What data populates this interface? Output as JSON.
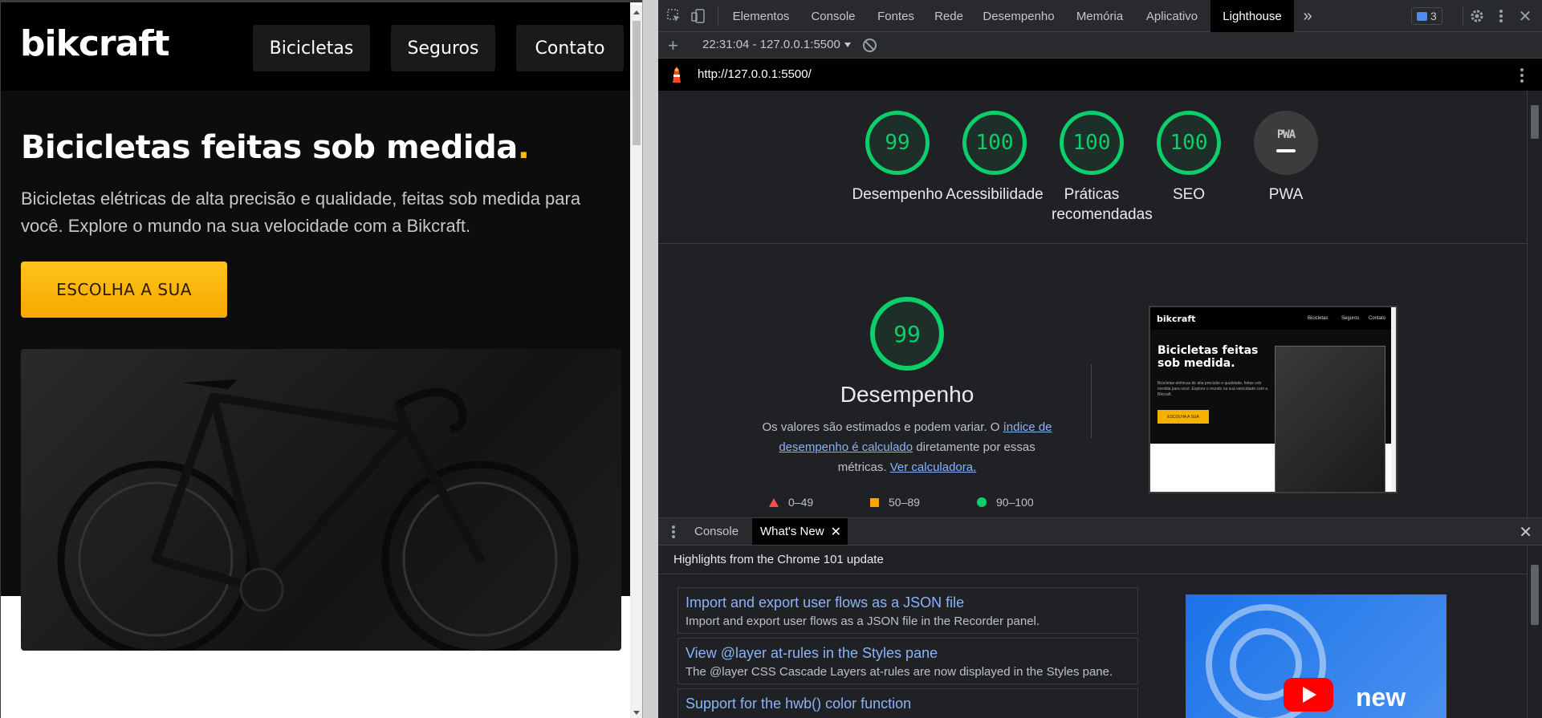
{
  "site": {
    "logo": "bikcraft",
    "nav": [
      "Bicicletas",
      "Seguros",
      "Contato"
    ],
    "hero_title": "Bicicletas feitas sob medida",
    "hero_title_dot": ".",
    "hero_text": "Bicicletas elétricas de alta precisão e qualidade, feitas sob medida para você. Explore o mundo na sua velocidade com a Bikcraft.",
    "cta": "ESCOLHA A SUA",
    "bike_image_alt": "bicicleta"
  },
  "devtools": {
    "tabs": [
      "Elementos",
      "Console",
      "Fontes",
      "Rede",
      "Desempenho",
      "Memória",
      "Aplicativo",
      "Lighthouse"
    ],
    "active_tab": "Lighthouse",
    "more_tabs": "»",
    "issues_count": "3",
    "run_selector": "22:31:04 - 127.0.0.1:5500",
    "url": "http://127.0.0.1:5500/"
  },
  "lighthouse": {
    "scores": [
      {
        "label": "Desempenho",
        "value": "99"
      },
      {
        "label": "Acessibilidade",
        "value": "100"
      },
      {
        "label": "Práticas recomendadas",
        "value": "100"
      },
      {
        "label": "SEO",
        "value": "100"
      }
    ],
    "pwa_label": "PWA",
    "pwa_badge": "PWA",
    "performance": {
      "score": "99",
      "title": "Desempenho",
      "desc_1": "Os valores são estimados e podem variar. O ",
      "desc_link_1": "índice de desempenho é calculado",
      "desc_2": " diretamente por essas métricas. ",
      "desc_link_2": "Ver calculadora."
    },
    "legend": [
      "0–49",
      "50–89",
      "90–100"
    ],
    "screenshot": {
      "logo": "bikcraft",
      "nav": [
        "Bicicletas",
        "Seguros",
        "Contato"
      ],
      "title": "Bicicletas feitas sob medida.",
      "text": "Bicicletas elétricas de alta precisão e qualidade, feitas sob medida para você. Explore o mundo na sua velocidade com a Bikcraft.",
      "cta": "ESCOLHA A SUA"
    }
  },
  "drawer": {
    "tabs": [
      "Console",
      "What's New"
    ],
    "active_tab": "What's New",
    "close_tab": "✕",
    "close_drawer": "✕",
    "header": "Highlights from the Chrome 101 update",
    "items": [
      {
        "title": "Import and export user flows as a JSON file",
        "desc": "Import and export user flows as a JSON file in the Recorder panel."
      },
      {
        "title": "View @layer at-rules in the Styles pane",
        "desc": "The @layer CSS Cascade Layers at-rules are now displayed in the Styles pane."
      },
      {
        "title": "Support for the hwb() color function",
        "desc": ""
      }
    ],
    "video_text": "new"
  }
}
